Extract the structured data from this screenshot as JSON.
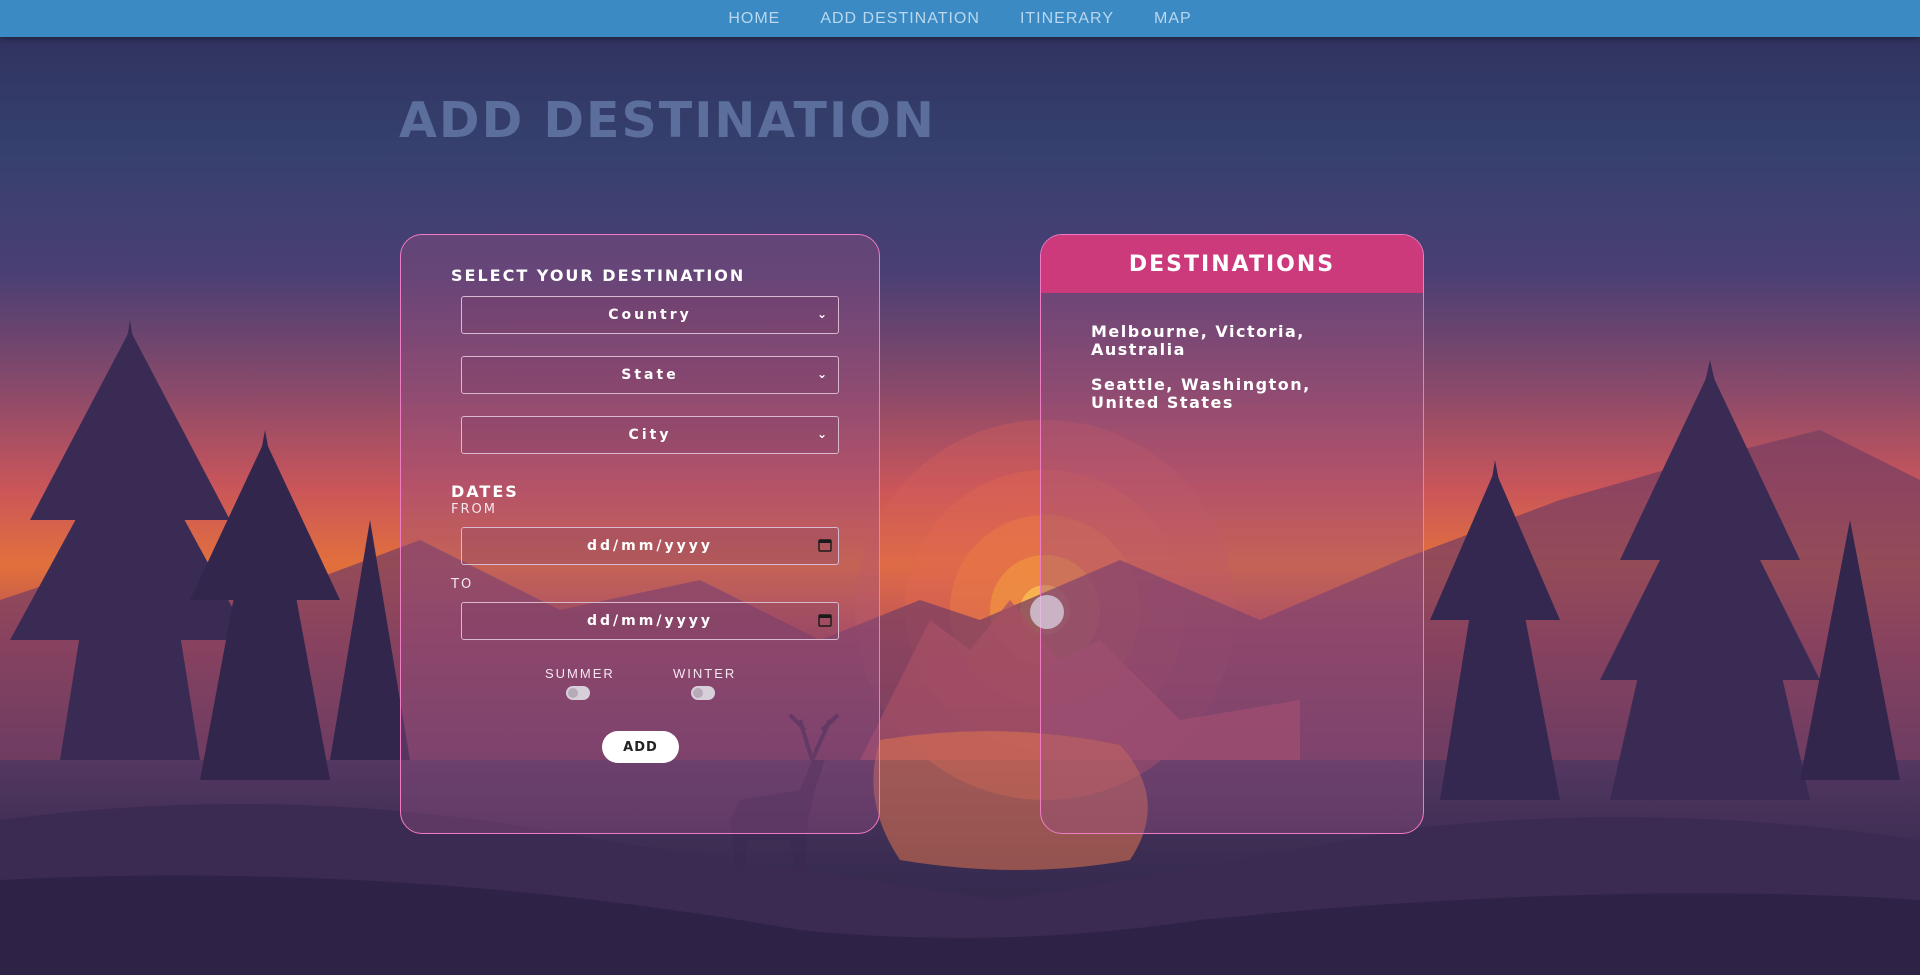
{
  "nav": {
    "items": [
      {
        "label": "HOME"
      },
      {
        "label": "ADD DESTINATION"
      },
      {
        "label": "ITINERARY"
      },
      {
        "label": "MAP"
      }
    ]
  },
  "page": {
    "title": "ADD DESTINATION"
  },
  "form": {
    "select_label": "SELECT YOUR DESTINATION",
    "country": {
      "selected": "Country"
    },
    "state": {
      "selected": "State"
    },
    "city": {
      "selected": "City"
    },
    "dates_label": "DATES",
    "from_label": "FROM",
    "from_placeholder": "dd/mm/yyyy",
    "to_label": "TO",
    "to_placeholder": "dd/mm/yyyy",
    "summer_label": "SUMMER",
    "winter_label": "WINTER",
    "summer_on": false,
    "winter_on": false,
    "add_label": "ADD"
  },
  "destinations": {
    "title": "DESTINATIONS",
    "items": [
      {
        "label": "Melbourne, Victoria, Australia"
      },
      {
        "label": "Seattle, Washington, United States"
      }
    ]
  },
  "colors": {
    "nav": "#3c8ac4",
    "panel_border": "#f07ac4",
    "dest_header": "#cc3a7c",
    "title": "#5b6e9c"
  }
}
